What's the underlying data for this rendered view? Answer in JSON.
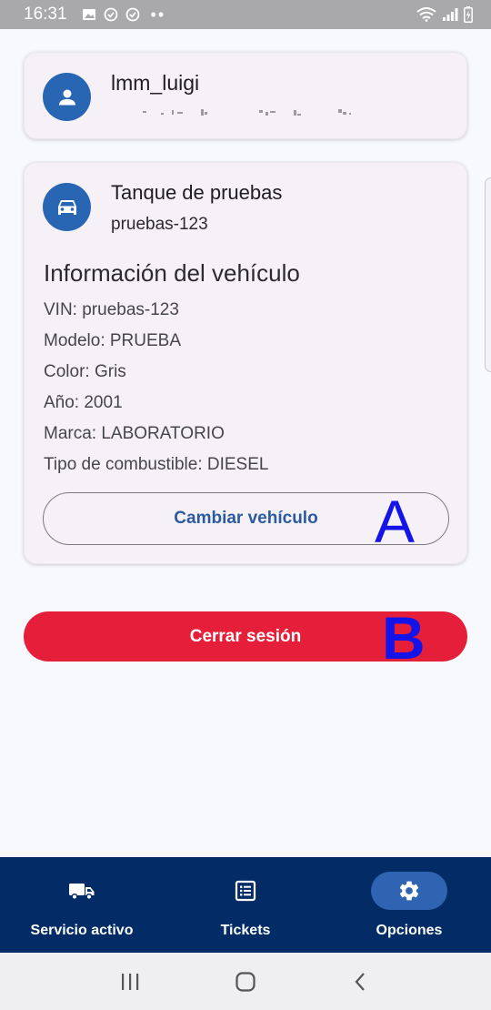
{
  "status_bar": {
    "time": "16:31"
  },
  "user_card": {
    "username": "lmm_luigi"
  },
  "vehicle_card": {
    "name": "Tanque de pruebas",
    "plate": "pruebas-123",
    "info_title": "Información del vehículo",
    "info_lines": [
      "VIN: pruebas-123",
      "Modelo: PRUEBA",
      "Color: Gris",
      "Año: 2001",
      "Marca: LABORATORIO",
      "Tipo de combustible: DIESEL"
    ],
    "change_button": "Cambiar vehículo"
  },
  "markers": {
    "a": "A",
    "b": "B"
  },
  "logout_button": "Cerrar sesión",
  "bottom_nav": {
    "items": [
      {
        "label": "Servicio activo",
        "icon": "truck-icon",
        "active": false
      },
      {
        "label": "Tickets",
        "icon": "list-icon",
        "active": false
      },
      {
        "label": "Opciones",
        "icon": "gear-icon",
        "active": true
      }
    ]
  },
  "colors": {
    "primary": "#2866b3",
    "danger": "#e51f3a",
    "nav_background": "#032c66",
    "active_pill": "#2f64b3"
  }
}
